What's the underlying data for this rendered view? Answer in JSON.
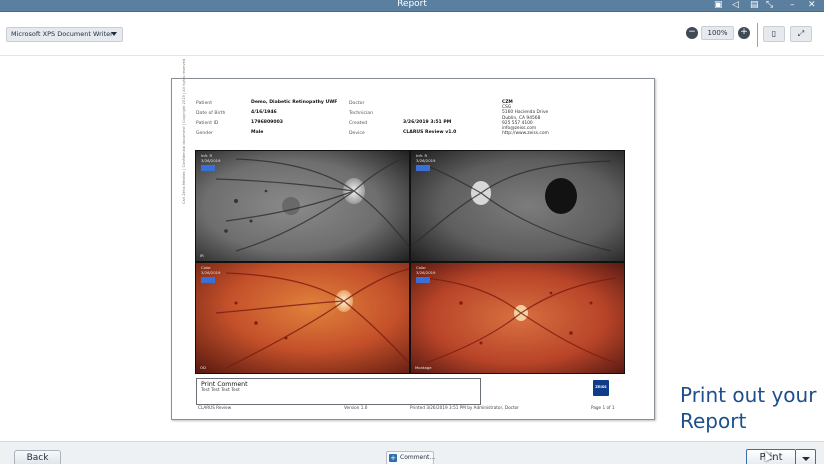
{
  "window": {
    "title": "Report",
    "controls": [
      "print-icon",
      "back-icon",
      "save-icon",
      "collapse-icon",
      "minimize-icon",
      "close-icon"
    ]
  },
  "toolbar": {
    "printer": "Microsoft XPS Document Writer",
    "zoom": "100%",
    "zoom_out_icon": "minus-icon",
    "zoom_in_icon": "plus-icon",
    "fit_page_icon": "fit-page-icon",
    "expand_icon": "expand-icon"
  },
  "report": {
    "labels": {
      "patient": "Patient",
      "dob": "Date of Birth",
      "patient_id": "Patient ID",
      "gender": "Gender",
      "doctor": "Doctor",
      "technician": "Technician",
      "created": "Created",
      "device": "Device"
    },
    "values": {
      "patient": "Demo, Diabetic Retinopathy UWF",
      "dob": "4/16/1946",
      "patient_id": "1796809003",
      "gender": "Male",
      "doctor": "",
      "technician": "",
      "created": "3/26/2019 3:51 PM",
      "device": "CLARUS Review v1.0"
    },
    "address": [
      "CZM",
      "CSG",
      "5160 Hacienda Drive",
      "Dublin, CA 94568",
      "925 557 4100",
      "info@zeiss.com",
      "http://www.zeiss.com"
    ],
    "images": [
      {
        "label": "Infr. R",
        "date": "3/26/2019",
        "corner": "IR",
        "type": "ir"
      },
      {
        "label": "Infr. R",
        "date": "3/26/2019",
        "corner": "",
        "type": "ir"
      },
      {
        "label": "Color",
        "date": "3/26/2019",
        "corner": "OD",
        "type": "color"
      },
      {
        "label": "Color",
        "date": "3/26/2019",
        "corner": "Montage",
        "type": "color"
      }
    ],
    "comment": {
      "title": "Print Comment",
      "text": "Test Test Test Test"
    },
    "footer": {
      "left": "CLARUS Review",
      "center": "Version 1.0",
      "printed": "Printed 3/26/2019 3:51 PM by Administrator, Doctor",
      "page": "Page 1 of 1"
    },
    "logo": "ZEISS",
    "side_text": "Carl Zeiss Meditec | Confidential document | Copyright 2019 | All rights reserved"
  },
  "promo": {
    "line1": "Print out your",
    "line2": "Report"
  },
  "bottom": {
    "back": "Back",
    "comment": "Comment...",
    "print": "Print"
  },
  "colors": {
    "titlebar": "#5b7f9e",
    "promo_text": "#1d4f8c",
    "accent": "#3a6ea5"
  }
}
